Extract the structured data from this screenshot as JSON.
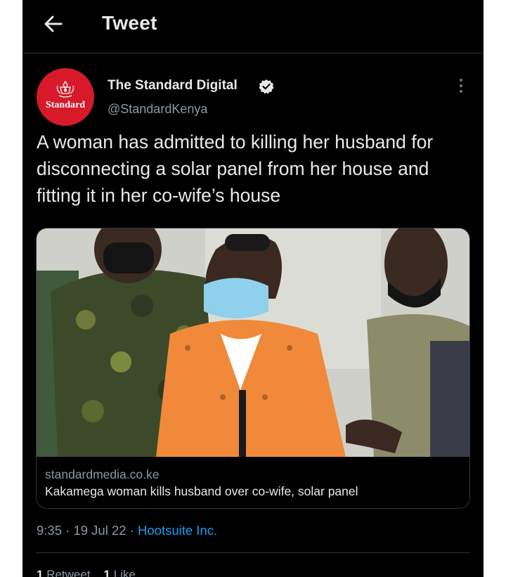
{
  "header": {
    "title": "Tweet",
    "back_icon": "arrow-left-icon"
  },
  "tweet": {
    "avatar_text": "Standard",
    "author_name": "The Standard Digital",
    "handle": "@StandardKenya",
    "verified": true,
    "text": "A woman has admitted to killing her husband for disconnecting a solar panel from her house and fitting it in her co-wife’s house",
    "card": {
      "domain": "standardmedia.co.ke",
      "title": "Kakamega woman kills husband over co-wife, solar panel"
    },
    "time": "9:35",
    "date": "19 Jul 22",
    "source": "Hootsuite Inc.",
    "stats": {
      "retweets_count": "1",
      "retweets_label": "Retweet",
      "likes_count": "1",
      "likes_label": "Like"
    }
  },
  "colors": {
    "background": "#000000",
    "text": "#e7e9ea",
    "secondary_text": "#8b98a5",
    "link": "#1d9bf0",
    "avatar_red": "#d7192a",
    "jacket_orange": "#f08a3a",
    "mask_blue": "#8fd0ec"
  }
}
